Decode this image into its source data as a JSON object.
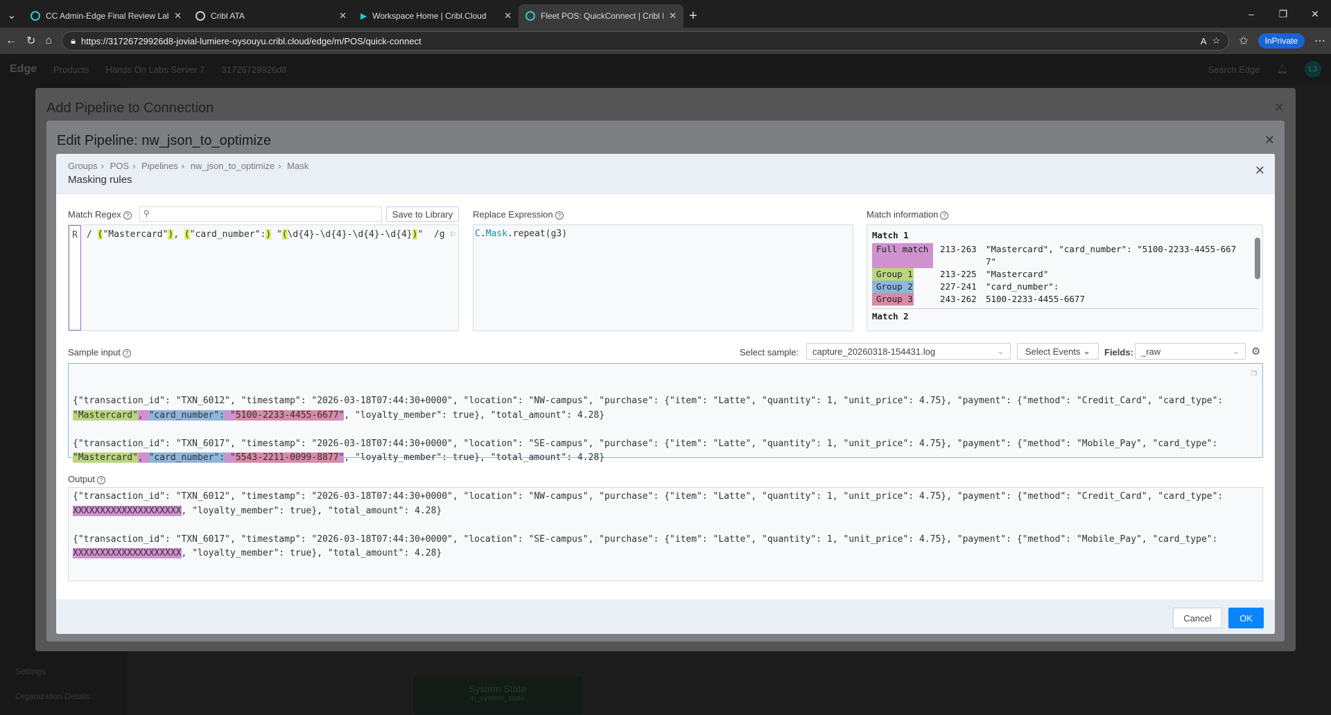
{
  "browser": {
    "tabs": [
      {
        "title": "CC Admin-Edge Final Review Lab",
        "active": false
      },
      {
        "title": "Cribl ATA",
        "active": false
      },
      {
        "title": "Workspace Home | Cribl.Cloud",
        "active": false
      },
      {
        "title": "Fleet POS: QuickConnect | Cribl Ed",
        "active": true
      }
    ],
    "url": "https://31726729926d8-jovial-lumiere-oysouyu.cribl.cloud/edge/m/POS/quick-connect",
    "inprivate": "InPrivate"
  },
  "app": {
    "brand": "Edge",
    "products": "Products",
    "server": "Hands On Labs Server 7",
    "instance": "31726729926d8",
    "search_placeholder": "Search Edge",
    "avatar": "L3",
    "side_settings": "Settings",
    "side_org": "Organization Details",
    "node_title": "System State",
    "node_sub": "in_system_state"
  },
  "modal_outer": {
    "title": "Add Pipeline to Connection"
  },
  "modal_mid": {
    "title": "Edit Pipeline: nw_json_to_optimize"
  },
  "masking": {
    "breadcrumb": [
      "Groups",
      "POS",
      "Pipelines",
      "nw_json_to_optimize",
      "Mask"
    ],
    "title": "Masking rules",
    "match_regex_label": "Match Regex",
    "save_to_library": "Save to Library",
    "regex_flag": "R",
    "regex_parts": {
      "p1": "(",
      "g1": "\"Mastercard\"",
      "p2": ")",
      "sep1": ", ",
      "p3": "(",
      "g2": "\"card_number\":",
      "p4": ")",
      "sep2": " \"",
      "p5": "(",
      "g3": "\\d{4}-\\d{4}-\\d{4}-\\d{4}",
      "p6": ")",
      "tail": "\"",
      "flags": "/g"
    },
    "replace_label": "Replace Expression",
    "replace_expr": {
      "obj": "C",
      "fn": "Mask",
      "rest": ".repeat(g3)"
    },
    "match_info_label": "Match information",
    "match": {
      "title": "Match 1",
      "rows": [
        {
          "tag": "Full match",
          "range": "213-263",
          "value": "\"Mastercard\", \"card_number\": \"5100-2233-4455-667\n7\"",
          "color": "#cf92cf"
        },
        {
          "tag": "Group 1",
          "range": "213-225",
          "value": "\"Mastercard\"",
          "color": "#bcd67f"
        },
        {
          "tag": "Group 2",
          "range": "227-241",
          "value": "\"card_number\":",
          "color": "#8fb5da"
        },
        {
          "tag": "Group 3",
          "range": "243-262",
          "value": "5100-2233-4455-6677",
          "color": "#d98aa6"
        }
      ],
      "next": "Match 2"
    },
    "sample_label": "Sample input",
    "select_sample_label": "Select sample:",
    "select_sample_value": "capture_20260318-154431.log",
    "select_events": "Select Events",
    "fields_label": "Fields:",
    "fields_value": "_raw",
    "events": [
      {
        "line1": "{\"transaction_id\": \"TXN_6012\", \"timestamp\": \"2026-03-18T07:44:30+0000\", \"location\": \"NW-campus\", \"purchase\": {\"item\": \"Latte\", \"quantity\": 1, \"unit_price\": 4.75}, \"payment\": {\"method\": \"Credit_Card\", \"card_type\":",
        "g1": "\"Mastercard\"",
        "s1": ", ",
        "g2": "\"card_number\":",
        "s2": " \"",
        "g3": "5100-2233-4455-6677",
        "s3": "\"",
        "rest": ", \"loyalty_member\": true}, \"total_amount\": 4.28}"
      },
      {
        "line1": "{\"transaction_id\": \"TXN_6017\", \"timestamp\": \"2026-03-18T07:44:30+0000\", \"location\": \"SE-campus\", \"purchase\": {\"item\": \"Latte\", \"quantity\": 1, \"unit_price\": 4.75}, \"payment\": {\"method\": \"Mobile_Pay\", \"card_type\":",
        "g1": "\"Mastercard\"",
        "s1": ", ",
        "g2": "\"card_number\":",
        "s2": " \"",
        "g3": "5543-2211-0099-8877",
        "s3": "\"",
        "rest": ", \"loyalty_member\": true}, \"total_amount\": 4.28}"
      }
    ],
    "output_label": "Output",
    "output": [
      {
        "line1": "{\"transaction_id\": \"TXN_6012\", \"timestamp\": \"2026-03-18T07:44:30+0000\", \"location\": \"NW-campus\", \"purchase\": {\"item\": \"Latte\", \"quantity\": 1, \"unit_price\": 4.75}, \"payment\": {\"method\": \"Credit_Card\", \"card_type\":",
        "masked": "XXXXXXXXXXXXXXXXXXXX",
        "rest": ", \"loyalty_member\": true}, \"total_amount\": 4.28}"
      },
      {
        "line1": "{\"transaction_id\": \"TXN_6017\", \"timestamp\": \"2026-03-18T07:44:30+0000\", \"location\": \"SE-campus\", \"purchase\": {\"item\": \"Latte\", \"quantity\": 1, \"unit_price\": 4.75}, \"payment\": {\"method\": \"Mobile_Pay\", \"card_type\":",
        "masked": "XXXXXXXXXXXXXXXXXXXX",
        "rest": ", \"loyalty_member\": true}, \"total_amount\": 4.28}"
      }
    ],
    "cancel": "Cancel",
    "ok": "OK",
    "accent": "#0a84ff"
  }
}
